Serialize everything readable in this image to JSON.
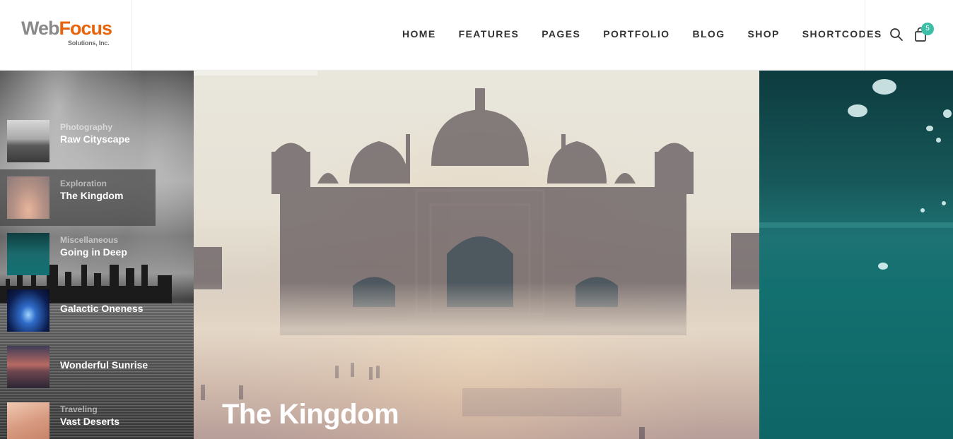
{
  "brand": {
    "name_part1": "Web",
    "name_part2": "Focus",
    "tagline": "Solutions, Inc."
  },
  "nav": {
    "items": [
      {
        "label": "HOME"
      },
      {
        "label": "FEATURES"
      },
      {
        "label": "PAGES"
      },
      {
        "label": "PORTFOLIO"
      },
      {
        "label": "BLOG"
      },
      {
        "label": "SHOP"
      },
      {
        "label": "SHORTCODES"
      }
    ]
  },
  "cart": {
    "count": "5"
  },
  "slider": {
    "thumbs": [
      {
        "category": "Photography",
        "title": "Raw Cityscape"
      },
      {
        "category": "Exploration",
        "title": "The Kingdom",
        "active": true
      },
      {
        "category": "Miscellaneous",
        "title": "Going in Deep"
      },
      {
        "category": "",
        "title": "Galactic Oneness"
      },
      {
        "category": "",
        "title": "Wonderful Sunrise"
      },
      {
        "category": "Traveling",
        "title": "Vast Deserts"
      }
    ],
    "current_title": "The Kingdom"
  },
  "colors": {
    "accent": "#e8640c",
    "badge": "#3dbea6"
  }
}
